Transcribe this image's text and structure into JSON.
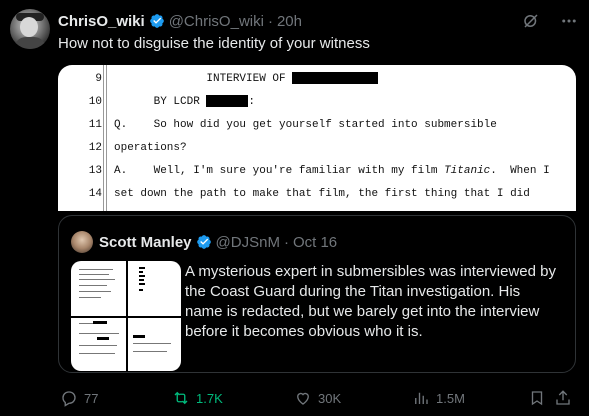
{
  "tweet": {
    "author_name": "ChrisO_wiki",
    "author_handle": "@ChrisO_wiki",
    "separator": "·",
    "time": "20h",
    "text": "How not to disguise the identity of your witness"
  },
  "document_image": {
    "lines": [
      {
        "num": "9",
        "text": "              INTERVIEW OF "
      },
      {
        "num": "10",
        "text": "      BY LCDR "
      },
      {
        "num": "11",
        "text": "Q.    So how did you get yourself started into submersible"
      },
      {
        "num": "12",
        "text": "operations?"
      },
      {
        "num": "13",
        "text": "A.    Well, I'm sure you're familiar with my film "
      },
      {
        "num": "14",
        "text": "set down the path to make that film, the first thing that I did"
      }
    ],
    "line10_suffix": ":",
    "line13_italic": "Titanic",
    "line13_suffix": ".  When I"
  },
  "quoted_tweet": {
    "author_name": "Scott Manley",
    "author_handle": "@DJSnM",
    "separator": "·",
    "date": "Oct 16",
    "text": "A mysterious expert in submersibles was interviewed by the Coast Guard during the Titan investigation. His name is redacted, but we barely get into the interview before it becomes obvious who it is."
  },
  "actions": {
    "replies": "77",
    "reposts": "1.7K",
    "likes": "30K",
    "views": "1.5M"
  },
  "colors": {
    "background": "#000000",
    "text": "#e7e9ea",
    "muted": "#71767b",
    "verified": "#1d9bf0",
    "repost_active": "#00ba7c",
    "border": "#2f3336"
  },
  "icons": [
    "verified-badge-icon",
    "grok-icon",
    "more-icon",
    "reply-icon",
    "repost-icon",
    "like-icon",
    "views-icon",
    "bookmark-icon",
    "share-icon"
  ]
}
